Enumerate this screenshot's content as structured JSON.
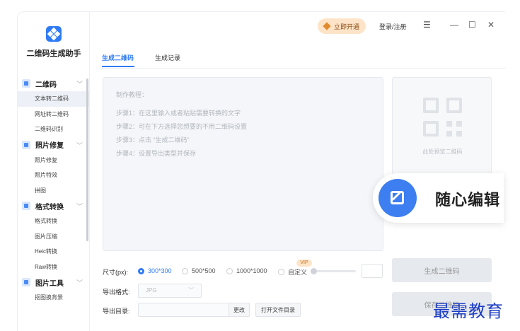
{
  "app": {
    "title": "二维码生成助手"
  },
  "header": {
    "vip_label": "立即开通",
    "login_label": "登录/注册",
    "menu_icon": "☰",
    "minimize_icon": "—",
    "maximize_icon": "☐",
    "close_icon": "✕"
  },
  "sidebar": {
    "categories": [
      {
        "label": "二维码",
        "items": [
          "文本转二维码",
          "网址转二维码",
          "二维码识别"
        ]
      },
      {
        "label": "照片修复",
        "items": [
          "照片修复",
          "照片特效",
          "拼图"
        ]
      },
      {
        "label": "格式转换",
        "items": [
          "格式转换",
          "图片压缩",
          "Heic转换",
          "Raw转换"
        ]
      },
      {
        "label": "图片工具",
        "items": [
          "抠图换背景"
        ]
      }
    ]
  },
  "tabs": [
    "生成二维码",
    "生成记录"
  ],
  "tutorial": {
    "title": "制作教程：",
    "steps": [
      "步骤1：在这里输入或者粘贴需要转换的文字",
      "步骤2：可在下方选择您想要的不用二维码设置",
      "步骤3：点击 “生成二维码”",
      "步骤4：设置导出类型并保存"
    ]
  },
  "preview": {
    "placeholder": "此处预览二维码"
  },
  "badge": {
    "text": "随心编辑"
  },
  "options": {
    "size_label": "尺寸(px):",
    "sizes": [
      "300*300",
      "500*500",
      "1000*1000",
      "自定义"
    ],
    "selected_size": "300*300",
    "vip_tag": "VIP",
    "format_label": "导出格式:",
    "format_value": "JPG",
    "dir_label": "导出目录:",
    "change_button": "更改",
    "open_folder_button": "打开文件目录"
  },
  "buttons": {
    "generate": "生成二维码",
    "save": "保存二维码"
  },
  "watermark": "最需教育",
  "colors": {
    "accent": "#2f7bf5",
    "vip_bg": "#fde4c8",
    "watermark": "#1a3cc4"
  }
}
